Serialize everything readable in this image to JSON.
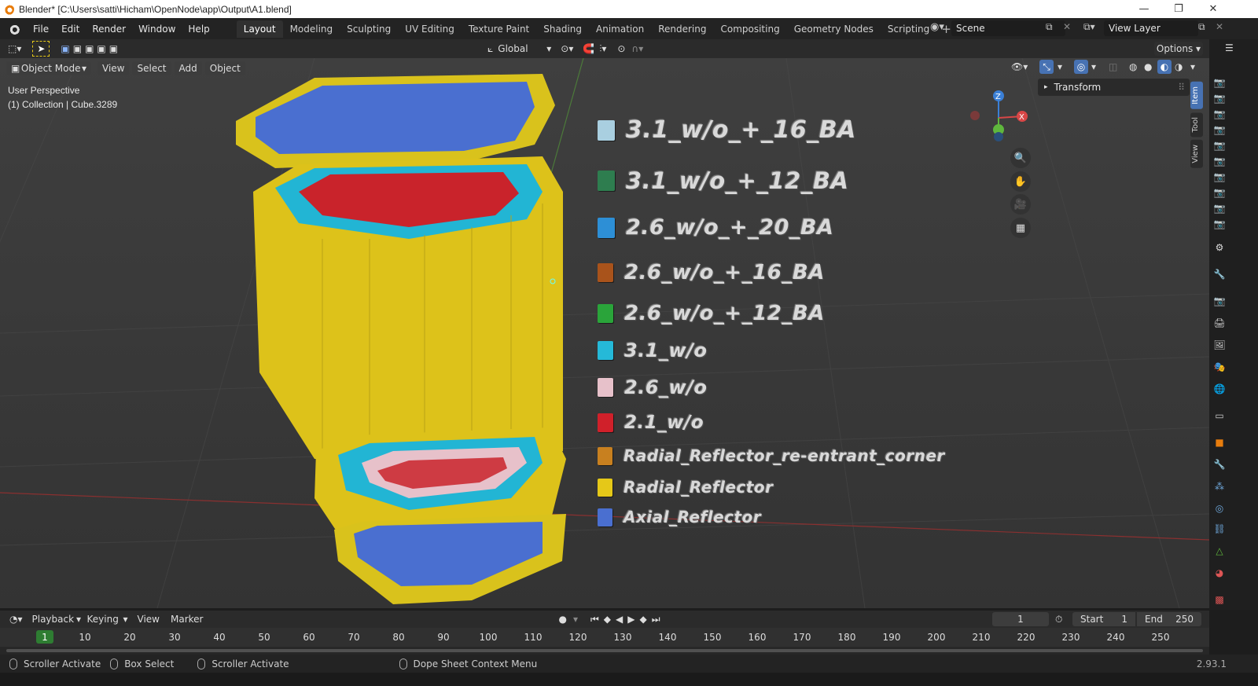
{
  "window": {
    "title": "Blender* [C:\\Users\\satti\\Hicham\\OpenNode\\app\\Output\\A1.blend]",
    "minimize": "—",
    "restore": "❐",
    "close": "✕"
  },
  "menu": [
    "File",
    "Edit",
    "Render",
    "Window",
    "Help"
  ],
  "workspaces": [
    "Layout",
    "Modeling",
    "Sculpting",
    "UV Editing",
    "Texture Paint",
    "Shading",
    "Animation",
    "Rendering",
    "Compositing",
    "Geometry Nodes",
    "Scripting"
  ],
  "active_workspace": "Layout",
  "scene": {
    "label": "Scene"
  },
  "view_layer": {
    "label": "View Layer"
  },
  "header": {
    "mode": "Object Mode",
    "view": "View",
    "select": "Select",
    "add": "Add",
    "object": "Object",
    "orientation": "Global",
    "options": "Options"
  },
  "viewport": {
    "perspective": "User Perspective",
    "collection": "(1) Collection | Cube.3289",
    "gizmo": {
      "z": "Z",
      "x": "X"
    }
  },
  "legend": [
    {
      "label": "3.1_w/o_+_16_BA",
      "color": "#a9cfe0"
    },
    {
      "label": "3.1_w/o_+_12_BA",
      "color": "#2e7d4f"
    },
    {
      "label": "2.6_w/o_+_20_BA",
      "color": "#2d8fd6"
    },
    {
      "label": "2.6_w/o_+_16_BA",
      "color": "#a9531b"
    },
    {
      "label": "2.6_w/o_+_12_BA",
      "color": "#2aa43a"
    },
    {
      "label": "3.1_w/o",
      "color": "#25b9d8"
    },
    {
      "label": "2.6_w/o",
      "color": "#e7c1ca"
    },
    {
      "label": "2.1_w/o",
      "color": "#d0202a"
    },
    {
      "label": "Radial_Reflector_re-entrant_corner",
      "color": "#c8801f"
    },
    {
      "label": "Radial_Reflector",
      "color": "#e5c818"
    },
    {
      "label": "Axial_Reflector",
      "color": "#4a6fd0"
    }
  ],
  "n_panel": {
    "transform": "Transform",
    "tabs": [
      "Item",
      "Tool",
      "View"
    ]
  },
  "timeline": {
    "playback": "Playback",
    "keying": "Keying",
    "view": "View",
    "marker": "Marker",
    "current_frame": "1",
    "start_label": "Start",
    "start": "1",
    "end_label": "End",
    "end": "250",
    "ruler": [
      "10",
      "20",
      "30",
      "40",
      "50",
      "60",
      "70",
      "80",
      "90",
      "100",
      "110",
      "120",
      "130",
      "140",
      "150",
      "160",
      "170",
      "180",
      "190",
      "200",
      "210",
      "220",
      "230",
      "240",
      "250"
    ]
  },
  "status": {
    "a": "Scroller Activate",
    "b": "Box Select",
    "c": "Scroller Activate",
    "d": "Dope Sheet Context Menu",
    "version": "2.93.1"
  }
}
